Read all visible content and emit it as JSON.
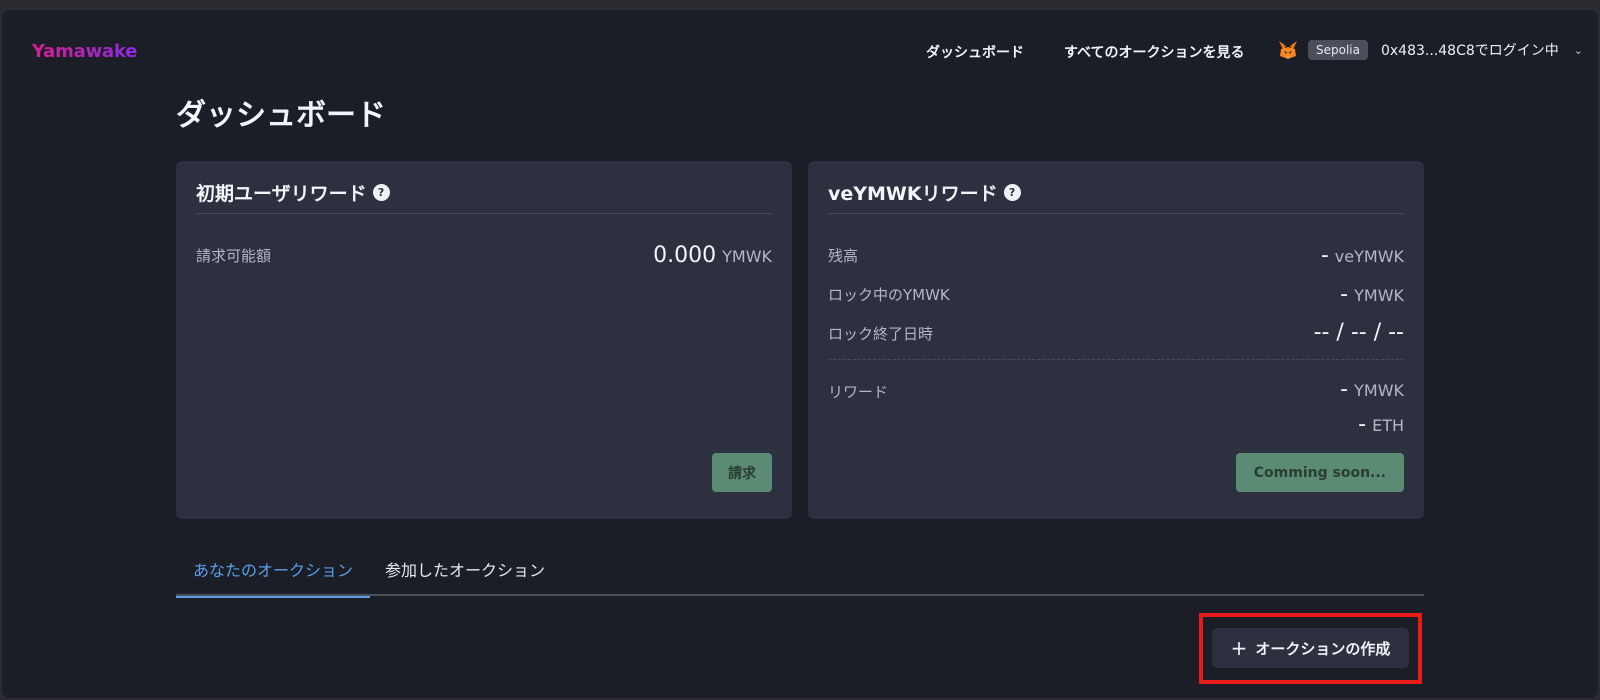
{
  "header": {
    "logo": "Yamawake",
    "nav": {
      "dashboard": "ダッシュボード",
      "all_auctions": "すべてのオークションを見る"
    },
    "account": {
      "network": "Sepolia",
      "address": "0x483...48C8でログイン中",
      "caret": "⌄"
    }
  },
  "page_title": "ダッシュボード",
  "early_user_card": {
    "title": "初期ユーザリワード",
    "claimable_label": "請求可能額",
    "claimable_value": "0.000",
    "claimable_unit": "YMWK",
    "claim_button": "請求"
  },
  "ve_card": {
    "title": "veYMWKリワード",
    "balance_label": "残高",
    "balance_value": "-",
    "balance_unit": "veYMWK",
    "locked_label": "ロック中のYMWK",
    "locked_value": "-",
    "locked_unit": "YMWK",
    "lock_end_label": "ロック終了日時",
    "lock_end_value": "-- / -- / --",
    "reward_label": "リワード",
    "reward_ymwk_value": "-",
    "reward_ymwk_unit": "YMWK",
    "reward_eth_value": "-",
    "reward_eth_unit": "ETH",
    "button": "Comming soon..."
  },
  "tabs": {
    "yours": "あなたのオークション",
    "joined": "参加したオークション"
  },
  "create_button": {
    "icon": "plus-icon",
    "label": "オークションの作成"
  },
  "colors": {
    "accent": "#5aa0e6",
    "green": "#5c8b73",
    "highlight": "#e81a1a"
  }
}
